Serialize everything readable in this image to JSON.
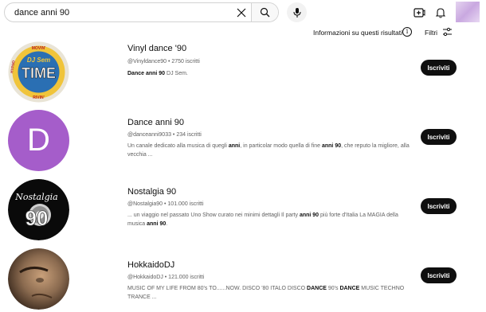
{
  "search": {
    "query": "dance anni 90"
  },
  "top_icons": [
    "close-icon",
    "search-icon",
    "microphone-icon",
    "create-icon",
    "notifications-icon"
  ],
  "filters": {
    "info_text": "Informazioni su questi risultati",
    "filters_label": "Filtri"
  },
  "channels": [
    {
      "name": "Vinyl dance '90",
      "meta": "@Vinyldance90 • 2750 iscritti",
      "desc_parts": [
        {
          "b": true,
          "t": "Dance anni 90"
        },
        {
          "b": false,
          "t": " DJ Sem."
        }
      ],
      "button": "Iscriviti",
      "avatar_text": [
        "DJ Sem",
        "TIME",
        "MOVIN'",
        "RIVIN'",
        "HYPNO"
      ],
      "avatar_colors": [
        "#2a6fb3",
        "#f0c43a"
      ]
    },
    {
      "name": "Dance anni 90",
      "meta": "@danceanni9033 • 234 iscritti",
      "desc_parts": [
        {
          "b": false,
          "t": "Un canale dedicato alla musica di quegli "
        },
        {
          "b": true,
          "t": "anni"
        },
        {
          "b": false,
          "t": ", in particolar modo quella di fine "
        },
        {
          "b": true,
          "t": "anni 90"
        },
        {
          "b": false,
          "t": ", che reputo la migliore, alla vecchia ..."
        }
      ],
      "button": "Iscriviti",
      "avatar_letter": "D",
      "avatar_colors": [
        "#a55dca"
      ]
    },
    {
      "name": "Nostalgia 90",
      "meta": "@Nostalgia90 • 101.000 iscritti",
      "desc_parts": [
        {
          "b": false,
          "t": "... un viaggio nel passato Uno Show curato nei minimi dettagli Il party "
        },
        {
          "b": true,
          "t": "anni 90"
        },
        {
          "b": false,
          "t": " più forte d'Italia La MAGIA della musica "
        },
        {
          "b": true,
          "t": "anni 90"
        },
        {
          "b": false,
          "t": "."
        }
      ],
      "button": "Iscriviti",
      "avatar_text": [
        "Nostalgia",
        "90"
      ],
      "avatar_colors": [
        "#0a0a0a"
      ]
    },
    {
      "name": "HokkaidoDJ",
      "meta": "@HokkaidoDJ • 121.000 iscritti",
      "desc_parts": [
        {
          "b": false,
          "t": "MUSIC OF MY LIFE FROM 80's TO......NOW. DISCO '80 ITALO DISCO "
        },
        {
          "b": true,
          "t": "DANCE"
        },
        {
          "b": false,
          "t": " 90's "
        },
        {
          "b": true,
          "t": "DANCE"
        },
        {
          "b": false,
          "t": " MUSIC TECHNO TRANCE ..."
        }
      ],
      "button": "Iscriviti",
      "avatar_colors": [
        "#8a6a4f",
        "#3b2a1e"
      ]
    }
  ]
}
